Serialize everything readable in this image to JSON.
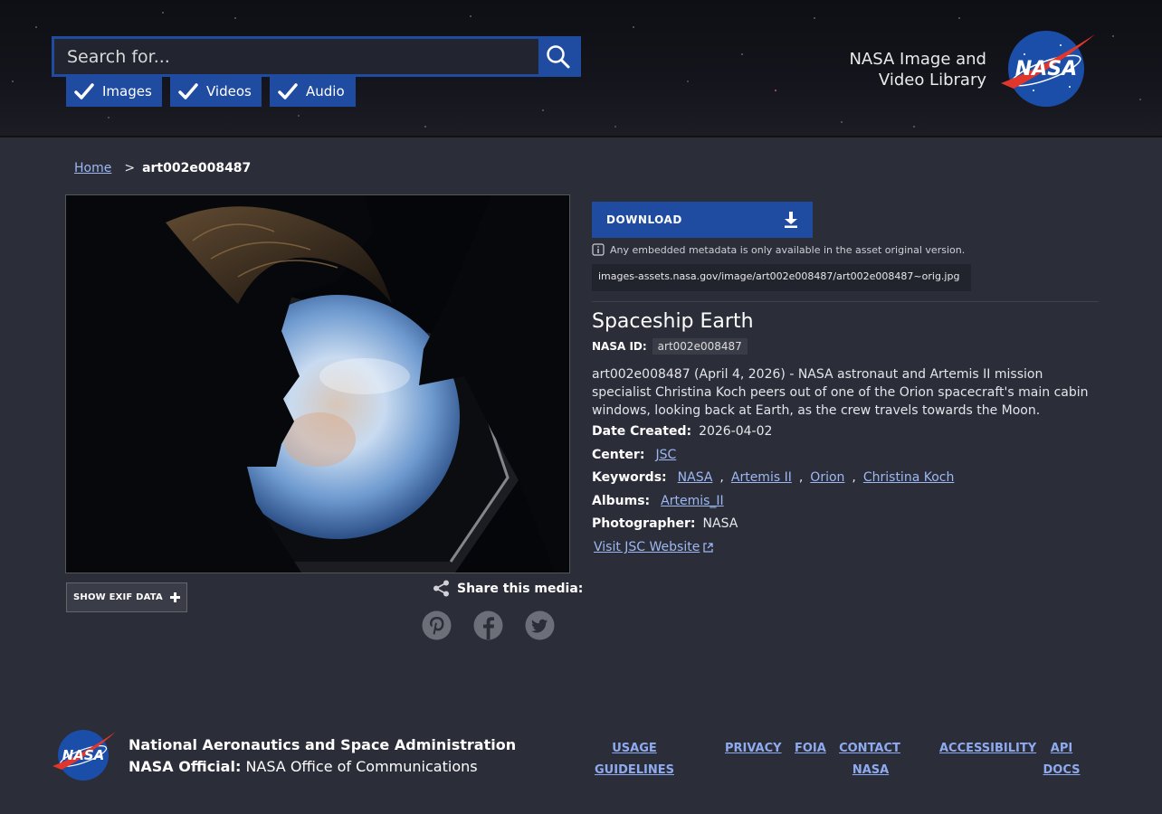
{
  "header": {
    "search_placeholder": "Search for...",
    "filters": [
      {
        "label": "Images",
        "checked": true
      },
      {
        "label": "Videos",
        "checked": true
      },
      {
        "label": "Audio",
        "checked": true
      }
    ],
    "brand_line1": "NASA Image and",
    "brand_line2": "Video Library",
    "logo_text": "NASA"
  },
  "breadcrumb": {
    "home": "Home",
    "separator": ">",
    "current": "art002e008487"
  },
  "media": {
    "exif_button": "SHOW EXIF DATA",
    "share_label": "Share this media:",
    "social": [
      "pinterest-icon",
      "facebook-icon",
      "twitter-icon"
    ]
  },
  "asset": {
    "download_label": "DOWNLOAD",
    "metadata_note": "Any embedded metadata is only available in the asset original version.",
    "url": "images-assets.nasa.gov/image/art002e008487/art002e008487~orig.jpg",
    "title": "Spaceship Earth",
    "nasa_id_label": "NASA ID:",
    "nasa_id": "art002e008487",
    "description": "art002e008487 (April 4, 2026) - NASA astronaut and Artemis II mission specialist Christina Koch peers out of one of the Orion spacecraft's main cabin windows, looking back at Earth, as the crew travels towards the Moon.",
    "date_label": "Date Created:",
    "date": "2026-04-02",
    "center_label": "Center:",
    "center": "JSC",
    "keywords_label": "Keywords:",
    "keywords": [
      "NASA",
      "Artemis II",
      "Orion",
      "Christina Koch"
    ],
    "albums_label": "Albums:",
    "album": "Artemis_II",
    "photographer_label": "Photographer:",
    "photographer": "NASA",
    "visit_link": "Visit JSC Website"
  },
  "footer": {
    "org_name": "National Aeronautics and Space Administration",
    "official_label": "NASA Official:",
    "official_value": "NASA Office of Communications",
    "links": {
      "usage_1": "USAGE",
      "usage_2": "GUIDELINES",
      "privacy": "PRIVACY",
      "foia": "FOIA",
      "contact_1": "CONTACT",
      "contact_2": "NASA",
      "accessibility": "ACCESSIBILITY",
      "api_1": "API",
      "api_2": "DOCS"
    }
  },
  "colors": {
    "accent": "#1f4ba0",
    "background": "#2b2d38",
    "link": "#9db8f2"
  }
}
